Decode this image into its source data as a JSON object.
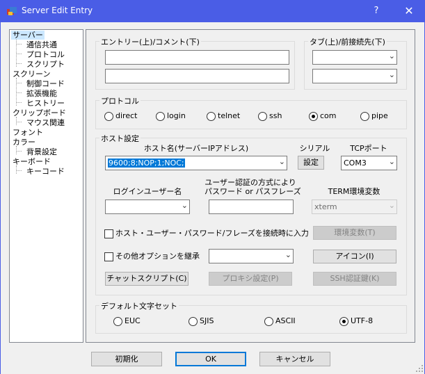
{
  "window": {
    "title": "Server Edit Entry",
    "help": "?",
    "close": "✕"
  },
  "tree": {
    "items": [
      {
        "label": "サーバー"
      },
      {
        "label": "通信共通"
      },
      {
        "label": "プロトコル"
      },
      {
        "label": "スクリプト"
      },
      {
        "label": "スクリーン"
      },
      {
        "label": "制御コード"
      },
      {
        "label": "拡張機能"
      },
      {
        "label": "ヒストリー"
      },
      {
        "label": "クリップボード"
      },
      {
        "label": "マウス関連"
      },
      {
        "label": "フォント"
      },
      {
        "label": "カラー"
      },
      {
        "label": "背景設定"
      },
      {
        "label": "キーボード"
      },
      {
        "label": "キーコード"
      }
    ]
  },
  "entry": {
    "label": "エントリー(上)/コメント(下)",
    "line1": "",
    "line2": ""
  },
  "tab": {
    "label": "タブ(上)/前接続先(下)",
    "combo1": "",
    "combo2": ""
  },
  "protocol": {
    "label": "プロトコル",
    "options": [
      "direct",
      "login",
      "telnet",
      "ssh",
      "com",
      "pipe"
    ],
    "selected": "com"
  },
  "host": {
    "label": "ホスト設定",
    "hostname_label": "ホスト名(サーバーIPアドレス)",
    "hostname_value": "9600;8;NOP;1;NOC;",
    "serial_label": "シリアル",
    "serial_button": "設定",
    "tcpport_label": "TCPポート",
    "tcpport_value": "COM3",
    "login_label": "ログインユーザー名",
    "login_value": "",
    "auth_label_line1": "ユーザー認証の方式により",
    "auth_label_line2": "パスワード or パスフレーズ",
    "auth_value": "",
    "term_label": "TERM環境変数",
    "term_value": "xterm",
    "check_input_label": "ホスト・ユーザー・パスワード/フレーズを接続時に入力",
    "env_button": "環境変数(T)",
    "check_inherit_label": "その他オプションを継承",
    "inherit_combo": "",
    "icon_button": "アイコン(I)",
    "chat_button": "チャットスクリプト(C)",
    "proxy_button": "プロキシ設定(P)",
    "sshkey_button": "SSH認証鍵(K)"
  },
  "charset": {
    "label": "デフォルト文字セット",
    "options": [
      "EUC",
      "SJIS",
      "ASCII",
      "UTF-8"
    ],
    "selected": "UTF-8"
  },
  "footer": {
    "init": "初期化",
    "ok": "OK",
    "cancel": "キャンセル"
  },
  "colors": {
    "titlebar": "#4a5de6",
    "focus": "#0078d7",
    "selection": "#cce8ff"
  }
}
